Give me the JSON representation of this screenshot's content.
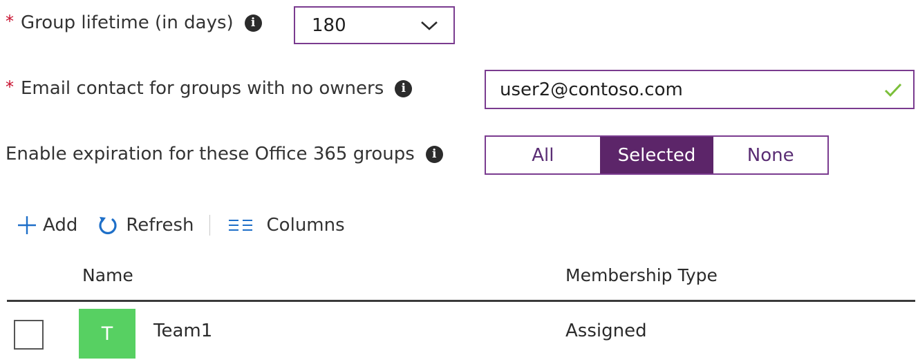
{
  "form": {
    "lifetime": {
      "required_mark": "*",
      "label": "Group lifetime (in days)",
      "info_glyph": "i",
      "value": "180"
    },
    "email_contact": {
      "required_mark": "*",
      "label": "Email contact for groups with no owners",
      "info_glyph": "i",
      "value": "user2@contoso.com",
      "valid": true
    },
    "expiration": {
      "label": "Enable expiration for these Office 365 groups",
      "info_glyph": "i",
      "options": [
        "All",
        "Selected",
        "None"
      ],
      "selected": "Selected"
    }
  },
  "toolbar": {
    "add_label": "Add",
    "refresh_label": "Refresh",
    "columns_label": "Columns"
  },
  "table": {
    "columns": [
      "Name",
      "Membership Type"
    ],
    "rows": [
      {
        "avatar_letter": "T",
        "avatar_color": "#57d062",
        "name": "Team1",
        "membership_type": "Assigned",
        "checked": false
      }
    ]
  },
  "colors": {
    "accent": "#7a3b8f",
    "selected_fill": "#5c2569",
    "required": "#c8102e",
    "valid_check": "#7bbf3a",
    "refresh_icon": "#1e6fc8",
    "add_icon": "#1e6fc8"
  }
}
